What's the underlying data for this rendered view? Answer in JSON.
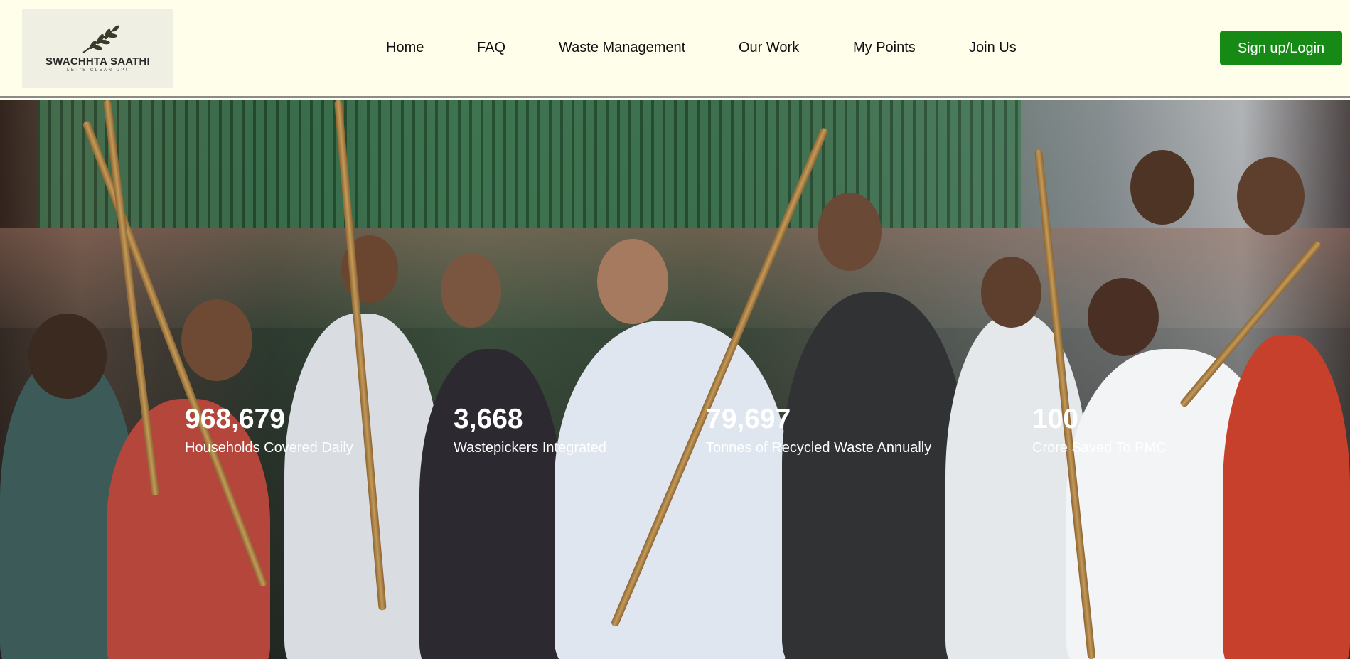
{
  "brand": {
    "name": "SWACHHTA SAATHI",
    "tagline": "LET'S CLEAN UP!",
    "logo_icon": "leaf-branch-icon"
  },
  "nav": {
    "items": [
      {
        "label": "Home"
      },
      {
        "label": "FAQ"
      },
      {
        "label": "Waste Management"
      },
      {
        "label": "Our Work"
      },
      {
        "label": "My Points"
      },
      {
        "label": "Join Us"
      }
    ],
    "signup_label": "Sign up/Login"
  },
  "hero": {
    "stats": [
      {
        "value": "968,679",
        "label": "Households Covered Daily"
      },
      {
        "value": "3,668",
        "label": "Wastepickers Integrated"
      },
      {
        "value": "79,697",
        "label": "Tonnes of Recycled Waste Annually"
      },
      {
        "value": "100",
        "label": "Crore Saved To PMC"
      }
    ]
  },
  "colors": {
    "page_background": "#fffeea",
    "accent_button": "#168a14",
    "stat_text": "#ffffff"
  }
}
